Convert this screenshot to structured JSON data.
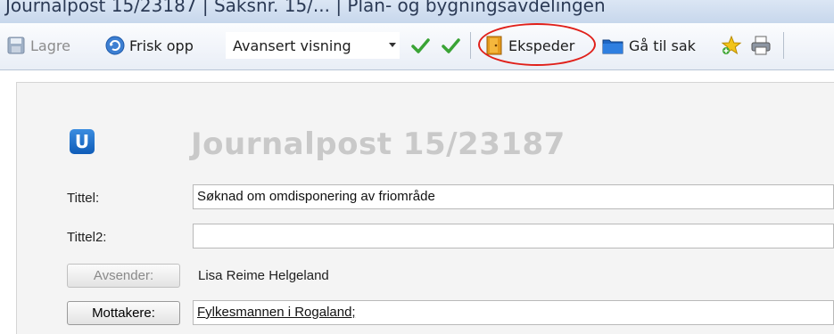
{
  "window": {
    "title": "Journalpost 15/23187 | Saksnr. 15/... | Plan- og bygningsavdelingen"
  },
  "toolbar": {
    "save_label": "Lagre",
    "refresh_label": "Frisk opp",
    "view_select_value": "Avansert visning",
    "expedite_label": "Ekspeder",
    "goto_case_label": "Gå til sak"
  },
  "journal": {
    "title": "Journalpost 15/23187",
    "logo_letter": "U"
  },
  "form": {
    "tittel_label": "Tittel:",
    "tittel_value": "Søknad om omdisponering av friområde",
    "tittel2_label": "Tittel2:",
    "tittel2_value": "",
    "avsender_button": "Avsender:",
    "avsender_value": "Lisa Reime Helgeland",
    "mottakere_button": "Mottakere:",
    "mottakere_value": "Fylkesmannen i Rogaland;"
  },
  "colors": {
    "annotation": "#e0201a",
    "accent": "#0f5cb8"
  }
}
